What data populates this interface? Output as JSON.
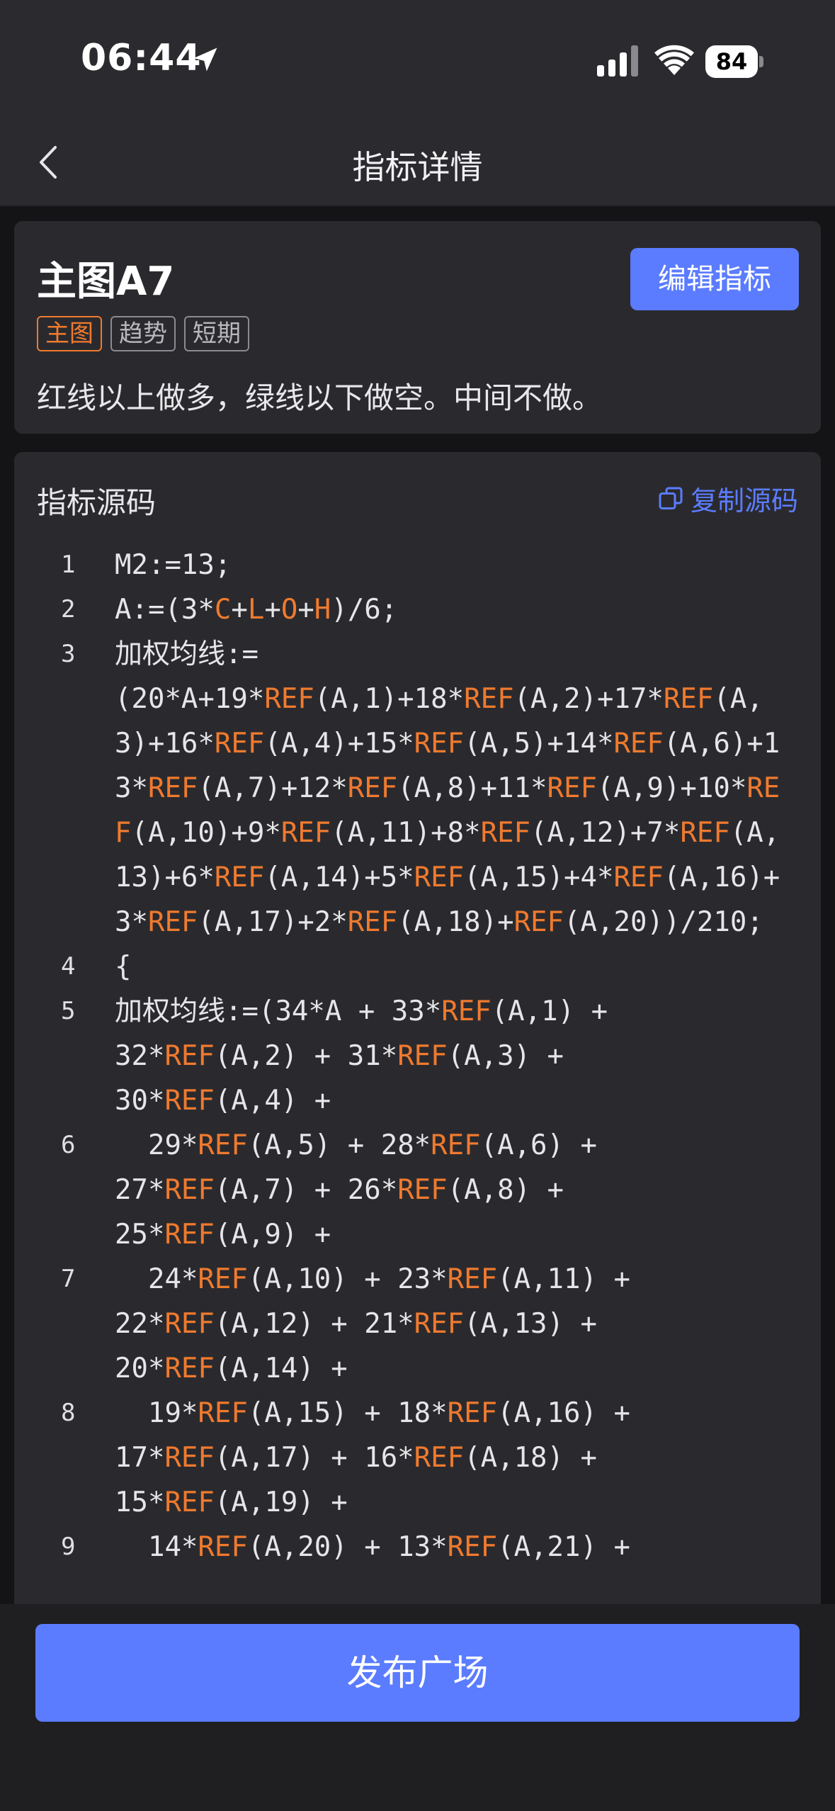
{
  "status_bar": {
    "time": "06:44",
    "battery": "84"
  },
  "nav": {
    "title": "指标详情"
  },
  "indicator": {
    "name": "主图A7",
    "edit_label": "编辑指标",
    "tags": [
      "主图",
      "趋势",
      "短期"
    ],
    "description": "红线以上做多，绿线以下做空。中间不做。"
  },
  "source": {
    "title": "指标源码",
    "copy_label": "复制源码",
    "lines": [
      {
        "n": "1",
        "text": "M2:=13;"
      },
      {
        "n": "2",
        "text": "A:=(3*C+L+O+H)/6;"
      },
      {
        "n": "3",
        "text": "加权均线:=\n(20*A+19*REF(A,1)+18*REF(A,2)+17*REF(A,3)+16*REF(A,4)+15*REF(A,5)+14*REF(A,6)+13*REF(A,7)+12*REF(A,8)+11*REF(A,9)+10*REF(A,10)+9*REF(A,11)+8*REF(A,12)+7*REF(A,13)+6*REF(A,14)+5*REF(A,15)+4*REF(A,16)+3*REF(A,17)+2*REF(A,18)+REF(A,20))/210;"
      },
      {
        "n": "4",
        "text": "{"
      },
      {
        "n": "5",
        "text": "加权均线:=(34*A + 33*REF(A,1) +\n32*REF(A,2) + 31*REF(A,3) +\n30*REF(A,4) +"
      },
      {
        "n": "6",
        "text": "  29*REF(A,5) + 28*REF(A,6) +\n27*REF(A,7) + 26*REF(A,8) +\n25*REF(A,9) +"
      },
      {
        "n": "7",
        "text": "  24*REF(A,10) + 23*REF(A,11) +\n22*REF(A,12) + 21*REF(A,13) +\n20*REF(A,14) +"
      },
      {
        "n": "8",
        "text": "  19*REF(A,15) + 18*REF(A,16) +\n17*REF(A,17) + 16*REF(A,18) +\n15*REF(A,19) +"
      },
      {
        "n": "9",
        "text": "  14*REF(A,20) + 13*REF(A,21) +"
      }
    ]
  },
  "footer": {
    "publish_label": "发布广场"
  },
  "colors": {
    "accent": "#5b7cff",
    "keyword": "#f07a2e",
    "background": "#141416",
    "card": "#2a2a2e"
  }
}
